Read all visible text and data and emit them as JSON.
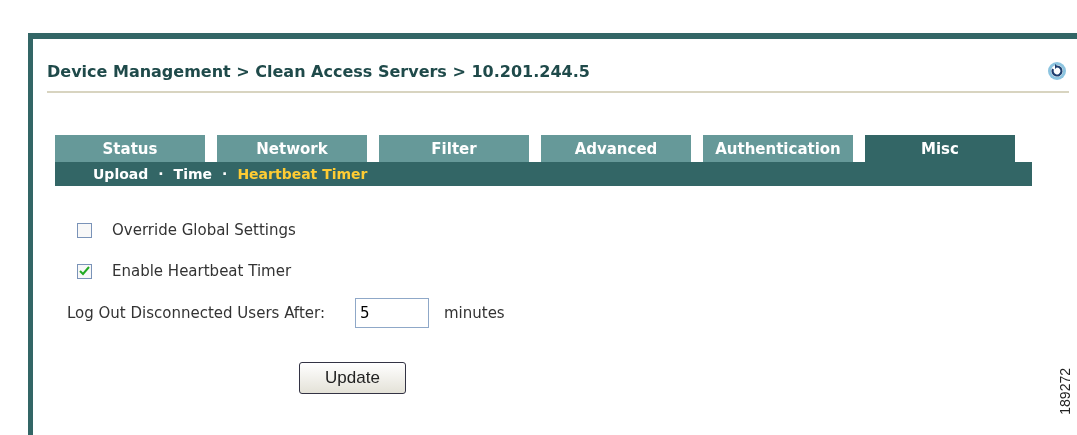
{
  "breadcrumb": "Device Management > Clean Access Servers > 10.201.244.5",
  "tabs": [
    {
      "label": "Status",
      "selected": false
    },
    {
      "label": "Network",
      "selected": false
    },
    {
      "label": "Filter",
      "selected": false
    },
    {
      "label": "Advanced",
      "selected": false
    },
    {
      "label": "Authentication",
      "selected": false
    },
    {
      "label": "Misc",
      "selected": true
    }
  ],
  "subtabs": [
    {
      "label": "Upload",
      "selected": false
    },
    {
      "label": "Time",
      "selected": false
    },
    {
      "label": "Heartbeat Timer",
      "selected": true
    }
  ],
  "subtab_separator": "·",
  "checkboxes": [
    {
      "label": "Override Global Settings",
      "checked": false
    },
    {
      "label": "Enable Heartbeat Timer",
      "checked": true
    }
  ],
  "logout": {
    "label": "Log Out Disconnected Users After:",
    "value": "5",
    "unit": "minutes"
  },
  "update_button": "Update",
  "figure_id": "189272"
}
